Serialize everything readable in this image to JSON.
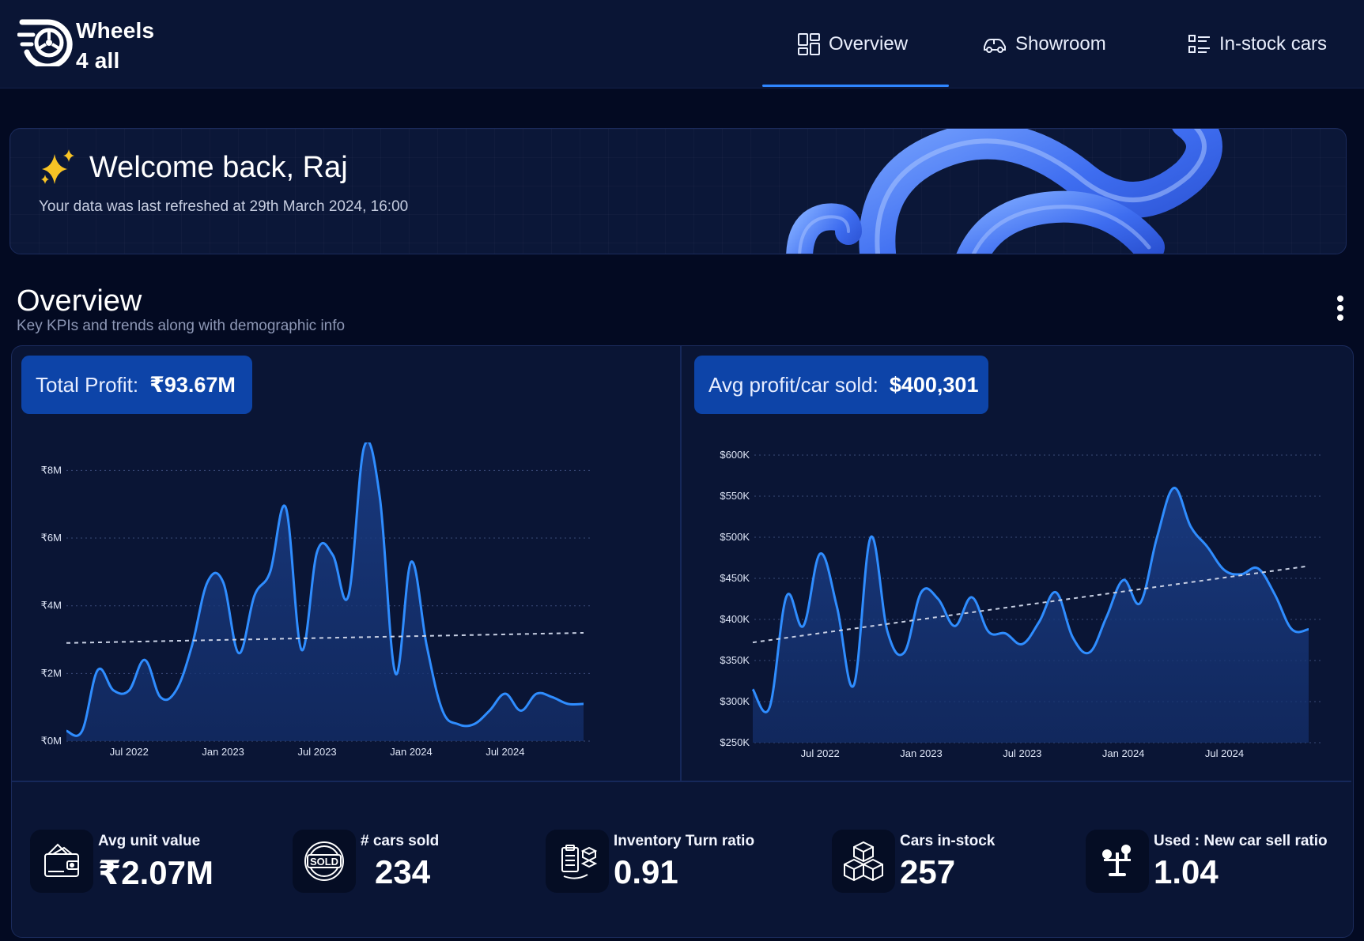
{
  "app": {
    "brand_line1": "Wheels",
    "brand_line2": "4 all",
    "accent_color": "#2f86ff"
  },
  "nav": {
    "items": [
      {
        "label": "Overview",
        "icon": "dashboard-icon",
        "active": true
      },
      {
        "label": "Showroom",
        "icon": "car-icon",
        "active": false
      },
      {
        "label": "In-stock cars",
        "icon": "list-icon",
        "active": false
      }
    ]
  },
  "welcome": {
    "title": "Welcome back, Raj",
    "subtitle": "Your data was last refreshed at 29th March 2024, 16:00"
  },
  "overview": {
    "title": "Overview",
    "subtitle": "Key KPIs and trends along with demographic info"
  },
  "kpis": {
    "total_profit_label": "Total Profit:",
    "total_profit_value": "₹93.67M",
    "avg_profit_label": "Avg profit/car sold:",
    "avg_profit_value": "$400,301"
  },
  "chart_data": [
    {
      "type": "area",
      "ylim": [
        0,
        8.5
      ],
      "y_ticks": [
        0,
        2,
        4,
        6,
        8
      ],
      "y_tick_labels": [
        "₹0M",
        "₹2M",
        "₹4M",
        "₹6M",
        "₹8M"
      ],
      "x_tick_labels": [
        "Jul 2022",
        "Jan 2023",
        "Jul 2023",
        "Jan 2024",
        "Jul 2024"
      ],
      "x": [
        "2022-03",
        "2022-04",
        "2022-05",
        "2022-06",
        "2022-07",
        "2022-08",
        "2022-09",
        "2022-10",
        "2022-11",
        "2022-12",
        "2023-01",
        "2023-02",
        "2023-03",
        "2023-04",
        "2023-05",
        "2023-06",
        "2023-07",
        "2023-08",
        "2023-09",
        "2023-10",
        "2023-11",
        "2023-12",
        "2024-01",
        "2024-02",
        "2024-03",
        "2024-04",
        "2024-05",
        "2024-06",
        "2024-07",
        "2024-08",
        "2024-09",
        "2024-10",
        "2024-11",
        "2024-12"
      ],
      "values": [
        0.3,
        0.3,
        2.1,
        1.5,
        1.5,
        2.4,
        1.3,
        1.5,
        2.8,
        4.7,
        4.7,
        2.6,
        4.3,
        5.0,
        6.9,
        2.7,
        5.6,
        5.5,
        4.3,
        8.7,
        7.2,
        2.0,
        5.3,
        2.8,
        0.9,
        0.5,
        0.5,
        0.9,
        1.4,
        0.9,
        1.4,
        1.3,
        1.1,
        1.1
      ],
      "trend": [
        2.9,
        3.2
      ],
      "line_color": "#2f8dff"
    },
    {
      "type": "area",
      "ylim": [
        250,
        600
      ],
      "y_ticks": [
        250,
        300,
        350,
        400,
        450,
        500,
        550,
        600
      ],
      "y_tick_labels": [
        "$250K",
        "$300K",
        "$350K",
        "$400K",
        "$450K",
        "$500K",
        "$550K",
        "$600K"
      ],
      "x_tick_labels": [
        "Jul 2022",
        "Jan 2023",
        "Jul 2023",
        "Jan 2024",
        "Jul 2024"
      ],
      "x": [
        "2022-03",
        "2022-04",
        "2022-05",
        "2022-06",
        "2022-07",
        "2022-08",
        "2022-09",
        "2022-10",
        "2022-11",
        "2022-12",
        "2023-01",
        "2023-02",
        "2023-03",
        "2023-04",
        "2023-05",
        "2023-06",
        "2023-07",
        "2023-08",
        "2023-09",
        "2023-10",
        "2023-11",
        "2023-12",
        "2024-01",
        "2024-02",
        "2024-03",
        "2024-04",
        "2024-05",
        "2024-06",
        "2024-07",
        "2024-08",
        "2024-09",
        "2024-10",
        "2024-11",
        "2024-12"
      ],
      "values": [
        315,
        293,
        428,
        392,
        480,
        415,
        320,
        500,
        385,
        360,
        433,
        425,
        392,
        427,
        385,
        383,
        370,
        397,
        433,
        378,
        360,
        403,
        448,
        420,
        500,
        560,
        513,
        488,
        460,
        455,
        462,
        430,
        388,
        388
      ],
      "trend": [
        372,
        465
      ],
      "line_color": "#2f8dff"
    }
  ],
  "stats": [
    {
      "label": "Avg unit value",
      "value": "₹2.07M",
      "icon": "wallet-icon"
    },
    {
      "label": "# cars sold",
      "value": "234",
      "icon": "sold-stamp-icon"
    },
    {
      "label": "Inventory Turn ratio",
      "value": "0.91",
      "icon": "inventory-icon"
    },
    {
      "label": "Cars in-stock",
      "value": "257",
      "icon": "boxes-icon"
    },
    {
      "label": "Used : New car sell ratio",
      "value": "1.04",
      "icon": "scale-icon"
    }
  ]
}
